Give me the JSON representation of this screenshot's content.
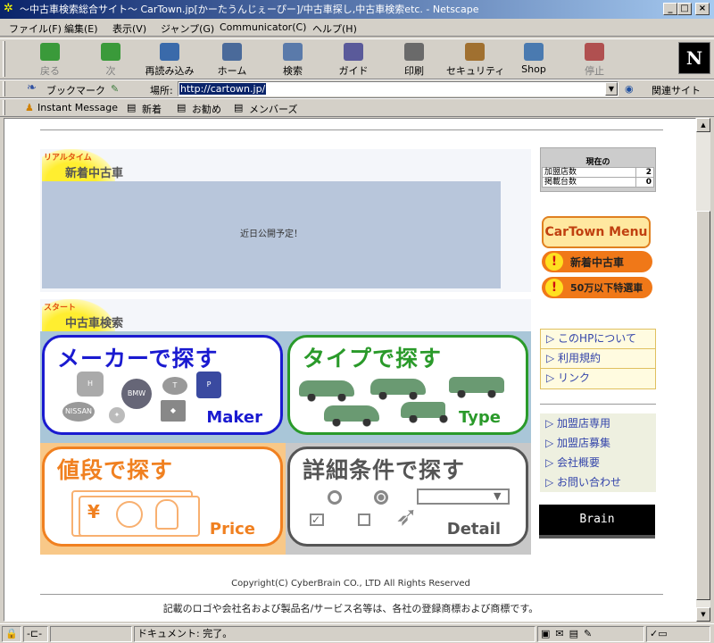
{
  "window": {
    "title": "〜中古車検索総合サイト〜 CarTown.jp[かーたうんじぇーぴー]/中古車探し,中古車検索etc. - Netscape",
    "controls": [
      "_",
      "□",
      "×"
    ]
  },
  "menu": [
    "ファイル(F)",
    "編集(E)",
    "表示(V)",
    "ジャンプ(G)",
    "Communicator(C)",
    "ヘルプ(H)"
  ],
  "toolbar": {
    "buttons": [
      {
        "label": "戻る",
        "icon": "back-arrow-icon",
        "color": "#3a9a3a",
        "disabled": true
      },
      {
        "label": "次",
        "icon": "forward-arrow-icon",
        "color": "#3a9a3a",
        "disabled": true
      },
      {
        "label": "再読み込み",
        "icon": "reload-icon",
        "color": "#3a6aaa",
        "disabled": false
      },
      {
        "label": "ホーム",
        "icon": "home-icon",
        "color": "#4a6a9a",
        "disabled": false
      },
      {
        "label": "検索",
        "icon": "search-icon",
        "color": "#5a7aaa",
        "disabled": false
      },
      {
        "label": "ガイド",
        "icon": "guide-icon",
        "color": "#5a5a9a",
        "disabled": false
      },
      {
        "label": "印刷",
        "icon": "print-icon",
        "color": "#6a6a6a",
        "disabled": false
      },
      {
        "label": "セキュリティ",
        "icon": "lock-icon",
        "color": "#a07030",
        "disabled": false
      },
      {
        "label": "Shop",
        "icon": "shop-icon",
        "color": "#4a7ab0",
        "disabled": false
      },
      {
        "label": "停止",
        "icon": "stop-icon",
        "color": "#b05050",
        "disabled": true
      }
    ],
    "logo": "N"
  },
  "location": {
    "bookmarks": "ブックマーク",
    "label": "場所:",
    "url": "http://cartown.jp/",
    "related": "関連サイト"
  },
  "personal": [
    "Instant Message",
    "新着",
    "お勧め",
    "メンバーズ"
  ],
  "page": {
    "new_section": {
      "tag_small": "リアルタイム",
      "tag_big": "新着中古車",
      "placeholder": "近日公開予定！"
    },
    "search_section": {
      "tag_small": "スタート",
      "tag_big": "中古車検索"
    },
    "cards": [
      {
        "title": "メーカーで探す",
        "en": "Maker",
        "color": "#1a1ad0"
      },
      {
        "title": "タイプで探す",
        "en": "Type",
        "color": "#2a9a2a"
      },
      {
        "title": "値段で探す",
        "en": "Price",
        "color": "#f08020"
      },
      {
        "title": "詳細条件で探す",
        "en": "Detail",
        "color": "#555555"
      }
    ],
    "maker_logos": [
      "HONDA",
      "BMW",
      "TOYOTA",
      "PEUGEOT",
      "NISSAN",
      "MB",
      "MITSUBISHI"
    ],
    "price_symbol": "¥",
    "counter": {
      "heading": "現在の",
      "rows": [
        {
          "label": "加盟店数",
          "value": "2"
        },
        {
          "label": "掲載台数",
          "value": "0"
        }
      ]
    },
    "menu_button": "CarTown Menu",
    "pills": [
      "新着中古車",
      "50万以下特選車"
    ],
    "links1": [
      "このHPについて",
      "利用規約",
      "リンク"
    ],
    "links2": [
      "加盟店専用",
      "加盟店募集",
      "会社概要",
      "お問い合わせ"
    ],
    "brain": "Brain",
    "copyright": "Copyright(C) CyberBrain CO., LTD All Rights Reserved",
    "trademark": "記載のロゴや会社名および製品名/サービス名等は、各社の登録商標および商標です。"
  },
  "status": {
    "text": "ドキュメント: 完了。"
  }
}
